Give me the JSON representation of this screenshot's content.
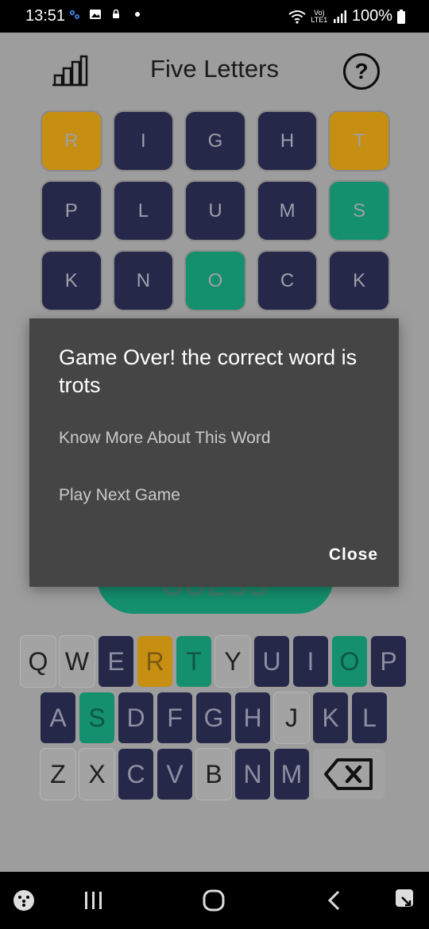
{
  "status_bar": {
    "time": "13:51",
    "battery": "100%",
    "network": "Vo) LTE1"
  },
  "app": {
    "title": "Five Letters",
    "help_symbol": "?"
  },
  "grid": [
    [
      {
        "letter": "R",
        "state": "present"
      },
      {
        "letter": "I",
        "state": "absent"
      },
      {
        "letter": "G",
        "state": "absent"
      },
      {
        "letter": "H",
        "state": "absent"
      },
      {
        "letter": "T",
        "state": "present"
      }
    ],
    [
      {
        "letter": "P",
        "state": "absent"
      },
      {
        "letter": "L",
        "state": "absent"
      },
      {
        "letter": "U",
        "state": "absent"
      },
      {
        "letter": "M",
        "state": "absent"
      },
      {
        "letter": "S",
        "state": "correct"
      }
    ],
    [
      {
        "letter": "K",
        "state": "absent"
      },
      {
        "letter": "N",
        "state": "absent"
      },
      {
        "letter": "O",
        "state": "correct"
      },
      {
        "letter": "C",
        "state": "absent"
      },
      {
        "letter": "K",
        "state": "absent"
      }
    ]
  ],
  "guess_button": {
    "label": "GUESS"
  },
  "keyboard": {
    "row1": [
      {
        "key": "Q",
        "state": "unused"
      },
      {
        "key": "W",
        "state": "unused"
      },
      {
        "key": "E",
        "state": "absent"
      },
      {
        "key": "R",
        "state": "present"
      },
      {
        "key": "T",
        "state": "correct"
      },
      {
        "key": "Y",
        "state": "unused"
      },
      {
        "key": "U",
        "state": "absent"
      },
      {
        "key": "I",
        "state": "absent"
      },
      {
        "key": "O",
        "state": "correct"
      },
      {
        "key": "P",
        "state": "absent"
      }
    ],
    "row2": [
      {
        "key": "A",
        "state": "absent"
      },
      {
        "key": "S",
        "state": "correct"
      },
      {
        "key": "D",
        "state": "absent"
      },
      {
        "key": "F",
        "state": "absent"
      },
      {
        "key": "G",
        "state": "absent"
      },
      {
        "key": "H",
        "state": "absent"
      },
      {
        "key": "J",
        "state": "unused"
      },
      {
        "key": "K",
        "state": "absent"
      },
      {
        "key": "L",
        "state": "absent"
      }
    ],
    "row3": [
      {
        "key": "Z",
        "state": "unused"
      },
      {
        "key": "X",
        "state": "unused"
      },
      {
        "key": "C",
        "state": "absent"
      },
      {
        "key": "V",
        "state": "absent"
      },
      {
        "key": "B",
        "state": "unused"
      },
      {
        "key": "N",
        "state": "absent"
      },
      {
        "key": "M",
        "state": "absent"
      }
    ],
    "backspace_icon": "backspace-icon"
  },
  "dialog": {
    "title": "Game Over! the correct word is trots",
    "items": [
      "Know More About This Word",
      "Play Next Game"
    ],
    "close_label": "Close"
  },
  "colors": {
    "absent": "#252848",
    "present": "#c68f12",
    "correct": "#14906f",
    "dialog_bg": "#454545",
    "scrim_bg": "#9d9d9d"
  }
}
